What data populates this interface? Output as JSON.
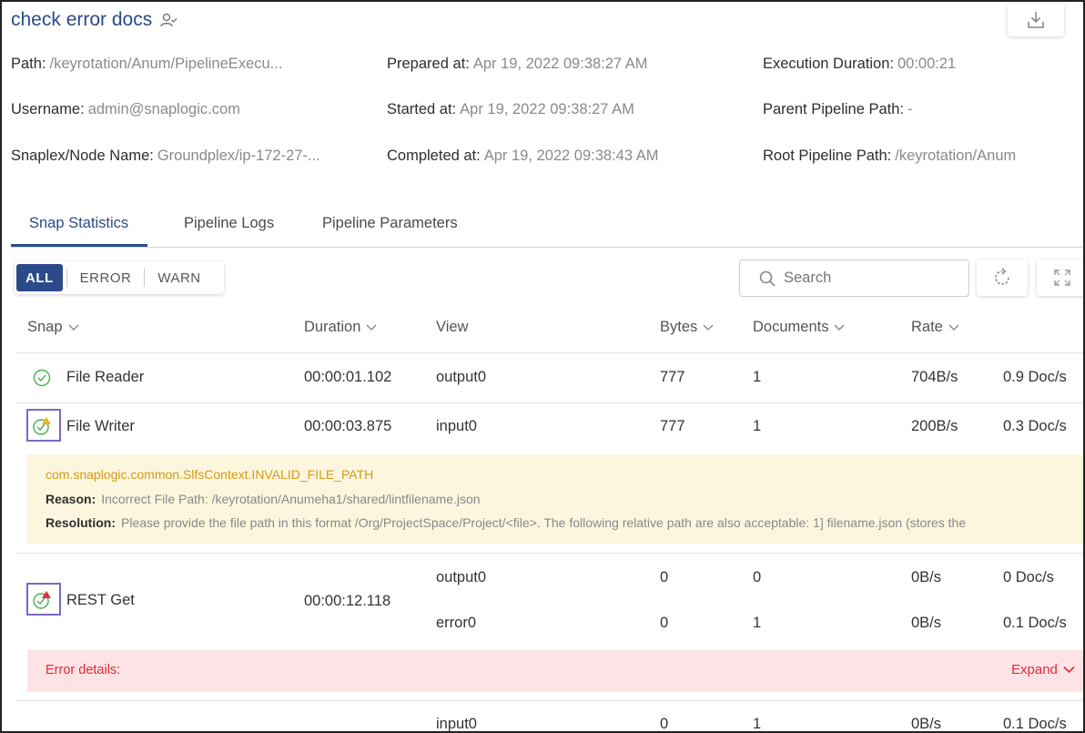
{
  "header": {
    "title": "check error docs"
  },
  "meta": {
    "path_label": "Path:",
    "path_value": "/keyrotation/Anum/PipelineExecu...",
    "username_label": "Username:",
    "username_value": "admin@snaplogic.com",
    "snaplex_label": "Snaplex/Node Name:",
    "snaplex_value": "Groundplex/ip-172-27-...",
    "prepared_label": "Prepared at:",
    "prepared_value": "Apr 19, 2022 09:38:27 AM",
    "started_label": "Started at:",
    "started_value": "Apr 19, 2022 09:38:27 AM",
    "completed_label": "Completed at:",
    "completed_value": "Apr 19, 2022 09:38:43 AM",
    "duration_label": "Execution Duration:",
    "duration_value": "00:00:21",
    "parent_label": "Parent Pipeline Path:",
    "parent_value": "-",
    "root_label": "Root Pipeline Path:",
    "root_value": "/keyrotation/Anum"
  },
  "tabs": [
    "Snap Statistics",
    "Pipeline Logs",
    "Pipeline Parameters"
  ],
  "filters": [
    "ALL",
    "ERROR",
    "WARN"
  ],
  "search": {
    "placeholder": "Search"
  },
  "columns": [
    "Snap",
    "Duration",
    "View",
    "Bytes",
    "Documents",
    "Rate"
  ],
  "rows": [
    {
      "snap": "File Reader",
      "duration": "00:00:01.102",
      "view": "output0",
      "bytes": "777",
      "documents": "1",
      "rate": "704B/s",
      "doc_rate": "0.9 Doc/s"
    },
    {
      "snap": "File Writer",
      "duration": "00:00:03.875",
      "view": "input0",
      "bytes": "777",
      "documents": "1",
      "rate": "200B/s",
      "doc_rate": "0.3 Doc/s"
    },
    {
      "snap": "REST Get",
      "duration": "00:00:12.118",
      "views": [
        {
          "view": "output0",
          "bytes": "0",
          "documents": "0",
          "rate": "0B/s",
          "doc_rate": "0 Doc/s"
        },
        {
          "view": "error0",
          "bytes": "0",
          "documents": "1",
          "rate": "0B/s",
          "doc_rate": "0.1 Doc/s"
        }
      ]
    },
    {
      "snap": "",
      "duration": "",
      "view": "input0",
      "bytes": "0",
      "documents": "1",
      "rate": "0B/s",
      "doc_rate": "0.1 Doc/s"
    }
  ],
  "warning": {
    "code": "com.snaplogic.common.SlfsContext.INVALID_FILE_PATH",
    "reason_label": "Reason:",
    "reason_value": "Incorrect File Path: /keyrotation/Anumeha1/shared/lintfilename.json",
    "resolution_label": "Resolution:",
    "resolution_value": "Please provide the file path in this format /Org/ProjectSpace/Project/<file>. The following relative path are also acceptable: 1] filename.json (stores the"
  },
  "error": {
    "label": "Error details:",
    "expand": "Expand"
  },
  "colors": {
    "brand": "#2b4a8a",
    "warning_bg": "#fdf6df",
    "warning_text": "#d69a12",
    "error_bg": "#fde3e6",
    "error_text": "#e02b3a",
    "success": "#4caf50"
  }
}
